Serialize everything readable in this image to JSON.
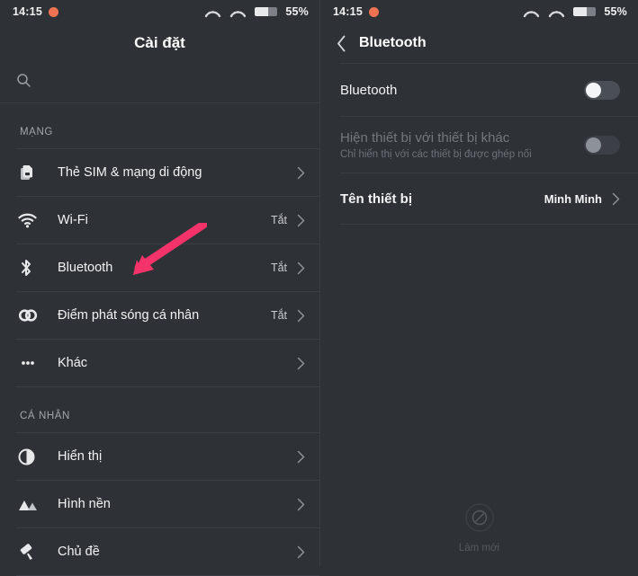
{
  "status_bar": {
    "time": "14:15",
    "notification_dot": "orange-dot-icon",
    "signal_icon_1": "signal-arc-icon",
    "signal_icon_2": "signal-arc-icon",
    "battery_icon": "battery-icon",
    "battery_percent": "55%"
  },
  "settings": {
    "title": "Cài đặt",
    "search_placeholder": "",
    "search_icon": "search-icon",
    "groups": [
      {
        "label": "MẠNG",
        "items": [
          {
            "icon": "sim-card-icon",
            "label": "Thẻ SIM & mạng di động",
            "value": ""
          },
          {
            "icon": "wifi-icon",
            "label": "Wi-Fi",
            "value": "Tắt"
          },
          {
            "icon": "bluetooth-icon",
            "label": "Bluetooth",
            "value": "Tắt"
          },
          {
            "icon": "hotspot-icon",
            "label": "Điểm phát sóng cá nhân",
            "value": "Tắt"
          },
          {
            "icon": "more-dots-icon",
            "label": "Khác",
            "value": ""
          }
        ]
      },
      {
        "label": "CÁ NHÂN",
        "items": [
          {
            "icon": "display-contrast-icon",
            "label": "Hiển thị",
            "value": ""
          },
          {
            "icon": "wallpaper-icon",
            "label": "Hình nền",
            "value": ""
          },
          {
            "icon": "theme-roller-icon",
            "label": "Chủ đề",
            "value": ""
          }
        ]
      }
    ]
  },
  "bluetooth": {
    "back_icon": "chevron-left-icon",
    "title": "Bluetooth",
    "rows": {
      "toggle_row": {
        "label": "Bluetooth",
        "toggle_state": "off"
      },
      "visibility_row": {
        "label": "Hiện thiết bị với thiết bị khác",
        "sublabel": "Chỉ hiển thị với các thiết bị được ghép nối",
        "toggle_state": "off-disabled"
      },
      "device_name_row": {
        "label": "Tên thiết bị",
        "value": "Minh Minh"
      }
    },
    "refresh": {
      "icon": "refresh-icon",
      "label": "Làm mới"
    }
  },
  "annotations": {
    "arrow_color": "#f5336b",
    "arrow_left_target": "Bluetooth",
    "arrow_right_target": "visibility-toggle"
  }
}
